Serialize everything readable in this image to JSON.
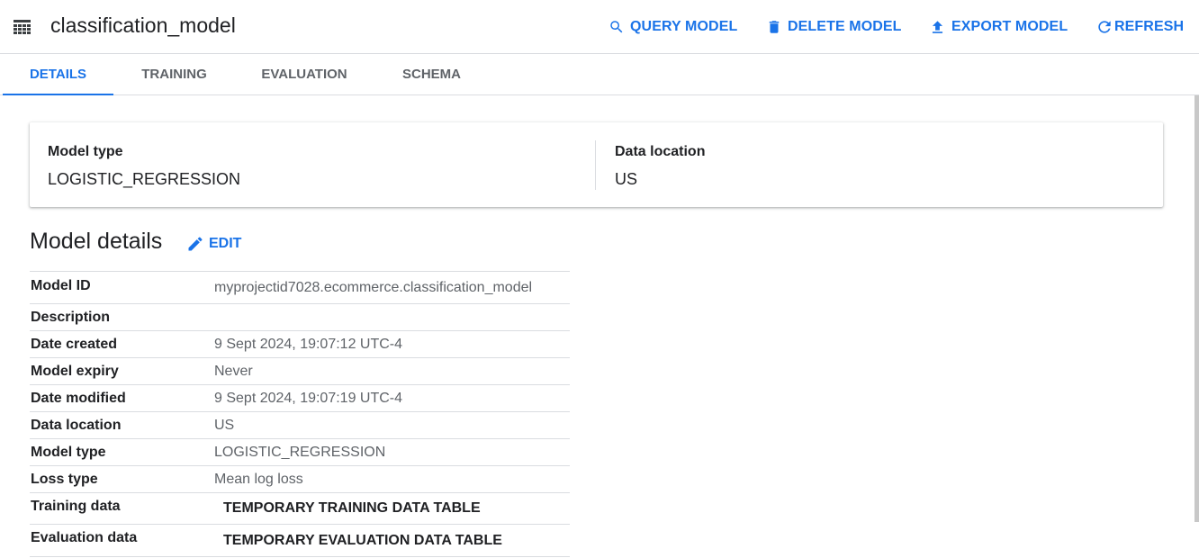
{
  "header": {
    "title": "classification_model",
    "icon": "table-grid-icon",
    "actions": {
      "query": "QUERY MODEL",
      "delete": "DELETE MODEL",
      "export": "EXPORT MODEL",
      "refresh": "REFRESH"
    }
  },
  "tabs": [
    "DETAILS",
    "TRAINING",
    "EVALUATION",
    "SCHEMA"
  ],
  "active_tab": "DETAILS",
  "summary": {
    "model_type_label": "Model type",
    "model_type_value": "LOGISTIC_REGRESSION",
    "data_location_label": "Data location",
    "data_location_value": "US"
  },
  "details": {
    "title": "Model details",
    "edit_label": "EDIT",
    "rows": [
      {
        "key": "Model ID",
        "value": "myprojectid7028.ecommerce.classification_model"
      },
      {
        "key": "Description",
        "value": ""
      },
      {
        "key": "Date created",
        "value": "9 Sept 2024, 19:07:12 UTC-4"
      },
      {
        "key": "Model expiry",
        "value": "Never"
      },
      {
        "key": "Date modified",
        "value": "9 Sept 2024, 19:07:19 UTC-4"
      },
      {
        "key": "Data location",
        "value": "US"
      },
      {
        "key": "Model type",
        "value": "LOGISTIC_REGRESSION"
      },
      {
        "key": "Loss type",
        "value": "Mean log loss"
      },
      {
        "key": "Training data",
        "link": "TEMPORARY TRAINING DATA TABLE"
      },
      {
        "key": "Evaluation data",
        "link": "TEMPORARY EVALUATION DATA TABLE"
      }
    ]
  },
  "colors": {
    "accent": "#1a73e8",
    "text": "#202124",
    "secondary_text": "#5f6368",
    "divider": "#dadce0"
  }
}
